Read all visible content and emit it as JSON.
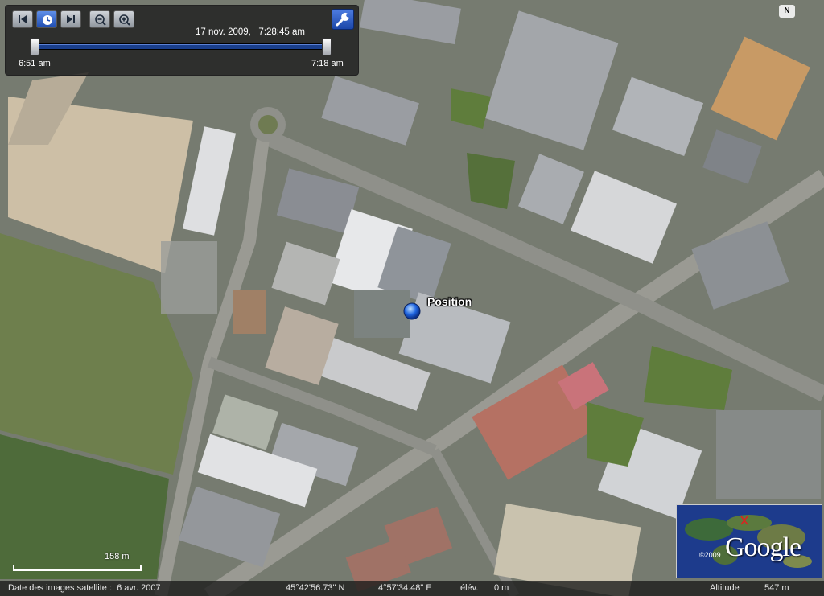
{
  "toolbar": {
    "datetime": "17 nov. 2009,   7:28:45 am",
    "start_time": "6:51 am",
    "end_time": "7:18 am"
  },
  "compass": {
    "label": "N"
  },
  "marker": {
    "label": "Position"
  },
  "scale": {
    "label": "158 m"
  },
  "status": {
    "imagery_date": "Date des images satellite :  6 avr. 2007",
    "latitude": "45°42'56.73\" N",
    "longitude": "4°57'34.48\" E",
    "elevation_label": "élév.",
    "elevation": "0 m",
    "altitude_label": "Altitude",
    "altitude": "547 m"
  },
  "logo": {
    "text": "Google",
    "copyright": "©2009"
  },
  "icons": [
    "skip-back-icon",
    "play-clock-icon",
    "skip-forward-icon",
    "zoom-out-icon",
    "zoom-in-icon",
    "wrench-icon",
    "position-marker-icon"
  ],
  "colors": {
    "track": "#1a3f8c",
    "accent": "#2a5cc8",
    "marker": "#1e64e0"
  }
}
